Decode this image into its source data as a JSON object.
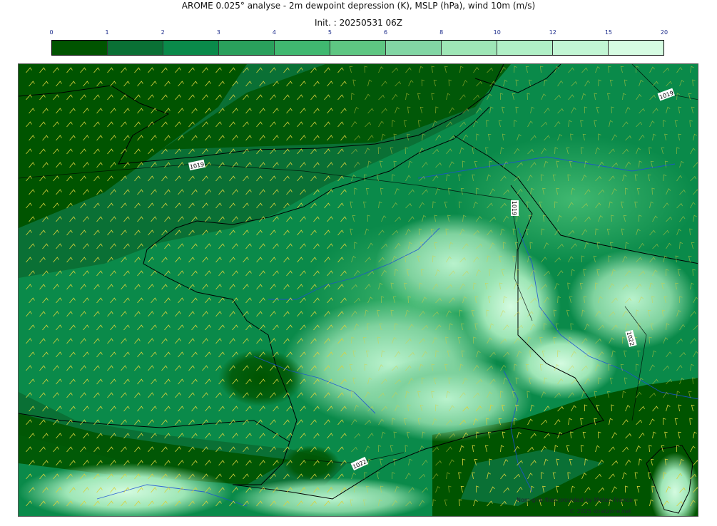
{
  "title": "AROME 0.025° analyse - 2m dewpoint depression (K), MSLP (hPa), wind 10m (m/s)",
  "init": "Init. : 20250531 06Z",
  "colorbar": {
    "ticks": [
      "0",
      "1",
      "2",
      "3",
      "4",
      "5",
      "6",
      "8",
      "10",
      "12",
      "15",
      "20"
    ],
    "colors": [
      "#005400",
      "#0a7035",
      "#0a8a4a",
      "#2aa05c",
      "#40b870",
      "#5ec682",
      "#82d6a4",
      "#9ee6b6",
      "#b0f0c6",
      "#c2f6d4",
      "#d6fce2"
    ]
  },
  "isobar_labels": [
    "1019",
    "1019",
    "1019",
    "1022",
    "1022"
  ],
  "credits": {
    "line1": "Nom-grib files provided by Meteo-France",
    "line2": "© 2025 stratzone.net"
  }
}
